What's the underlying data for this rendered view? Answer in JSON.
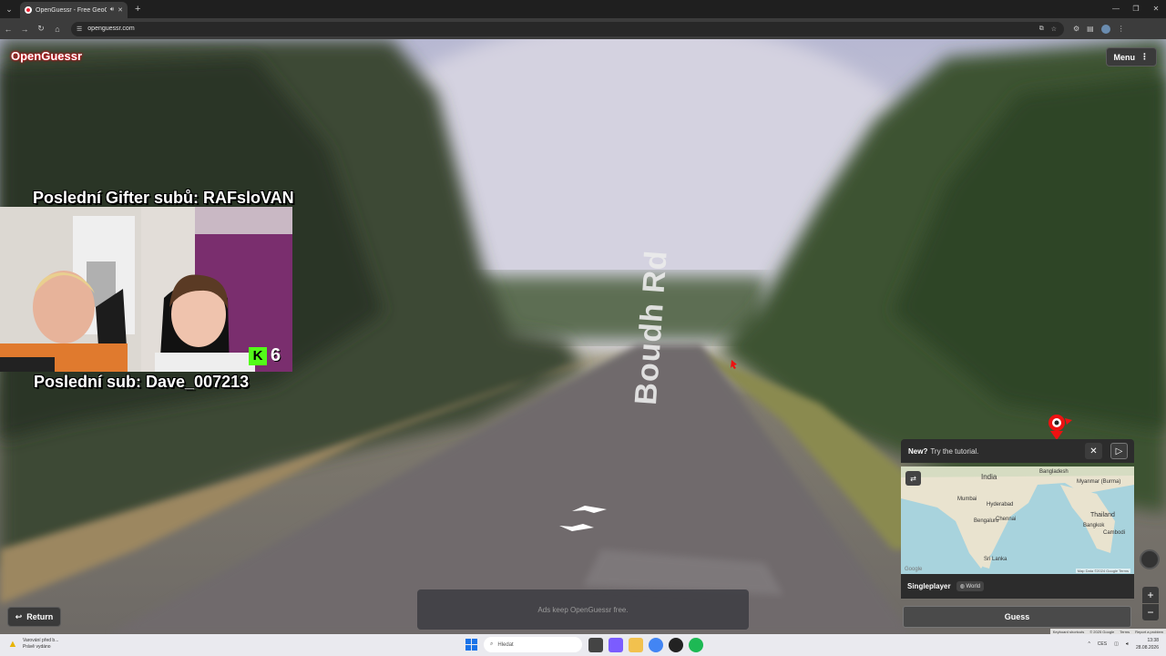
{
  "browser": {
    "tab_title": "OpenGuessr - Free GeoGuessr",
    "url": "openguessr.com",
    "colors": {
      "chrome_bg": "#1f1f1f",
      "toolbar_bg": "#3c3c3c"
    }
  },
  "game": {
    "brand": "OpenGuessr",
    "menu_label": "Menu",
    "return_label": "Return",
    "ad_text": "Ads keep OpenGuessr free.",
    "road_label": "Boudh Rd",
    "tutorial": {
      "new": "New?",
      "text": "Try the tutorial."
    },
    "mode": {
      "name": "Singleplayer",
      "map_chip": "World"
    },
    "guess_label": "Guess",
    "map_attribution": "Map Data ©2024 Google",
    "map_terms": "Terms",
    "map_labels": {
      "india": "India",
      "bangladesh": "Bangladesh",
      "myanmar": "Myanmar (Burma)",
      "mumbai": "Mumbai",
      "hyderabad": "Hyderabad",
      "bengaluru": "Bengaluru",
      "chennai": "Chennai",
      "thailand": "Thailand",
      "bangkok": "Bangkok",
      "cambodia": "Cambodi",
      "srilanka": "Sri Lanka",
      "google": "Google"
    },
    "legal": {
      "shortcuts": "Keyboard shortcuts",
      "copyright": "© 2025 Google",
      "terms": "Terms",
      "report": "Report a problem"
    },
    "accent": "#d0102a"
  },
  "stream": {
    "gifter_text": "Poslední Gifter subů: RAFsloVAN",
    "last_sub_text": "Poslední sub: Dave_007213",
    "sub_count": "6",
    "kick_letter": "K",
    "kick_color": "#53fc18"
  },
  "taskbar": {
    "warning_title": "Varování před b...",
    "warning_sub": "Právě vydáno",
    "search_placeholder": "Hledat",
    "lang": "CES",
    "time": "13:38",
    "date": "28.08.2026"
  }
}
